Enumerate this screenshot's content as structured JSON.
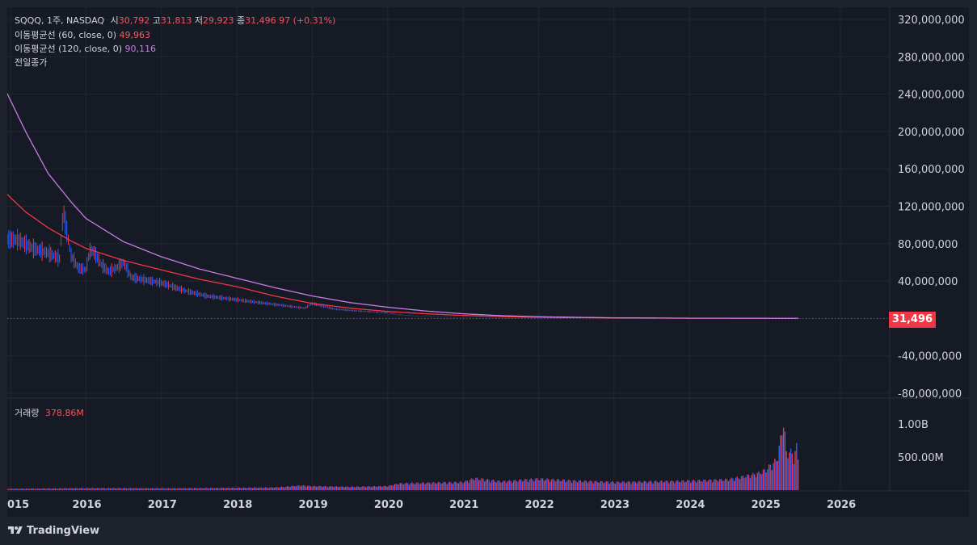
{
  "header": {
    "symbol": "SQQQ, 1주, NASDAQ",
    "open_label": "시",
    "open_value": "30,792",
    "high_label": "고",
    "high_value": "31,813",
    "low_label": "저",
    "low_value": "29,923",
    "close_label": "종",
    "close_value": "31,496",
    "change_value": "97 (+0.31%)"
  },
  "indicators": [
    {
      "label": "이동평균선 (60, close, 0)",
      "value": "49,963",
      "color": "#f23645"
    },
    {
      "label": "이동평균선 (120, close, 0)",
      "value": "90,116",
      "color": "#c77ce6"
    },
    {
      "label": "전일종가",
      "value": ""
    }
  ],
  "volume_pane": {
    "label": "거래량",
    "value": "378.86M"
  },
  "price_label": "31,496",
  "brand": "TradingView",
  "colors": {
    "up": "#f23645",
    "down": "#2962ff",
    "ma60": "#f23645",
    "ma120": "#c77ce6",
    "bg": "#161a25"
  },
  "chart_data": {
    "type": "line",
    "x_axis_ticks": [
      "015",
      "2016",
      "2017",
      "2018",
      "2019",
      "2020",
      "2021",
      "2022",
      "2023",
      "2024",
      "2025",
      "2026"
    ],
    "y_axis_ticks": [
      "320,000,000",
      "280,000,000",
      "240,000,000",
      "200,000,000",
      "160,000,000",
      "120,000,000",
      "80,000,000",
      "40,000,000",
      "-40,000,000",
      "-80,000,000"
    ],
    "y_axis_tick_values": [
      320000000,
      280000000,
      240000000,
      200000000,
      160000000,
      120000000,
      80000000,
      40000000,
      -40000000,
      -80000000
    ],
    "volume_axis_ticks": [
      "1.00B",
      "500.00M"
    ],
    "volume_axis_tick_values": [
      1000000000,
      500000000
    ],
    "ylim": [
      -80000000,
      320000000
    ],
    "last_close": 31496,
    "series": [
      {
        "name": "이동평균선 (60, close, 0)",
        "x": [
          2014.9,
          2015.2,
          2015.5,
          2015.8,
          2016.0,
          2016.5,
          2017.0,
          2017.5,
          2018.0,
          2018.5,
          2019.0,
          2019.5,
          2020.0,
          2020.5,
          2021.0,
          2021.5,
          2022.0,
          2023.0,
          2024.0,
          2025.0,
          2025.45
        ],
        "values": [
          137000000,
          114000000,
          97000000,
          83000000,
          75000000,
          62000000,
          52000000,
          42000000,
          34000000,
          24000000,
          16000000,
          11000000,
          7500000,
          5000000,
          3200000,
          2000000,
          1200000,
          500000,
          200000,
          80000,
          49963
        ]
      },
      {
        "name": "이동평균선 (120, close, 0)",
        "x": [
          2014.9,
          2015.2,
          2015.5,
          2015.8,
          2016.0,
          2016.5,
          2017.0,
          2017.5,
          2018.0,
          2018.5,
          2019.0,
          2019.5,
          2020.0,
          2020.5,
          2021.0,
          2021.5,
          2022.0,
          2023.0,
          2024.0,
          2025.0,
          2025.45
        ],
        "values": [
          250000000,
          200000000,
          155000000,
          125000000,
          107000000,
          82000000,
          66000000,
          53000000,
          43000000,
          33000000,
          24000000,
          17000000,
          12000000,
          8000000,
          5000000,
          3000000,
          1800000,
          700000,
          300000,
          130000,
          90116
        ]
      },
      {
        "name": "price",
        "x": [
          2014.9,
          2015.1,
          2015.3,
          2015.5,
          2015.65,
          2015.7,
          2015.8,
          2015.9,
          2016.0,
          2016.05,
          2016.1,
          2016.2,
          2016.3,
          2016.4,
          2016.5,
          2016.6,
          2016.8,
          2017.0,
          2017.3,
          2017.6,
          2018.0,
          2018.3,
          2018.6,
          2018.9,
          2019.0,
          2019.3,
          2019.6,
          2020.0,
          2020.15,
          2020.3,
          2020.6,
          2021.0,
          2021.5,
          2022.0,
          2022.5,
          2023.0,
          2024.0,
          2025.0,
          2025.45
        ],
        "values": [
          85000000,
          84000000,
          75000000,
          70000000,
          64000000,
          115000000,
          68000000,
          54000000,
          52000000,
          72000000,
          72000000,
          58000000,
          50000000,
          54000000,
          60000000,
          44000000,
          41000000,
          38000000,
          30000000,
          24000000,
          20000000,
          17000000,
          14000000,
          11000000,
          16000000,
          10000000,
          8000000,
          6000000,
          4000000,
          3000000,
          2000000,
          1000000,
          500000,
          300000,
          200000,
          100000,
          60000,
          40000,
          31496
        ]
      }
    ],
    "volume": {
      "x": [
        2014.9,
        2015.5,
        2016.0,
        2016.5,
        2017.0,
        2017.5,
        2018.0,
        2018.5,
        2018.85,
        2019.0,
        2019.5,
        2020.0,
        2020.15,
        2020.5,
        2021.0,
        2021.15,
        2021.5,
        2022.0,
        2022.5,
        2023.0,
        2023.5,
        2024.0,
        2024.5,
        2024.7,
        2024.9,
        2025.0,
        2025.15,
        2025.2,
        2025.25,
        2025.28,
        2025.32,
        2025.38,
        2025.42,
        2025.45
      ],
      "values": [
        20000000,
        25000000,
        30000000,
        30000000,
        28000000,
        30000000,
        35000000,
        40000000,
        70000000,
        60000000,
        50000000,
        60000000,
        100000000,
        110000000,
        120000000,
        180000000,
        130000000,
        170000000,
        140000000,
        120000000,
        130000000,
        140000000,
        160000000,
        200000000,
        250000000,
        300000000,
        450000000,
        700000000,
        1100000000,
        550000000,
        600000000,
        520000000,
        650000000,
        378860000
      ]
    }
  }
}
